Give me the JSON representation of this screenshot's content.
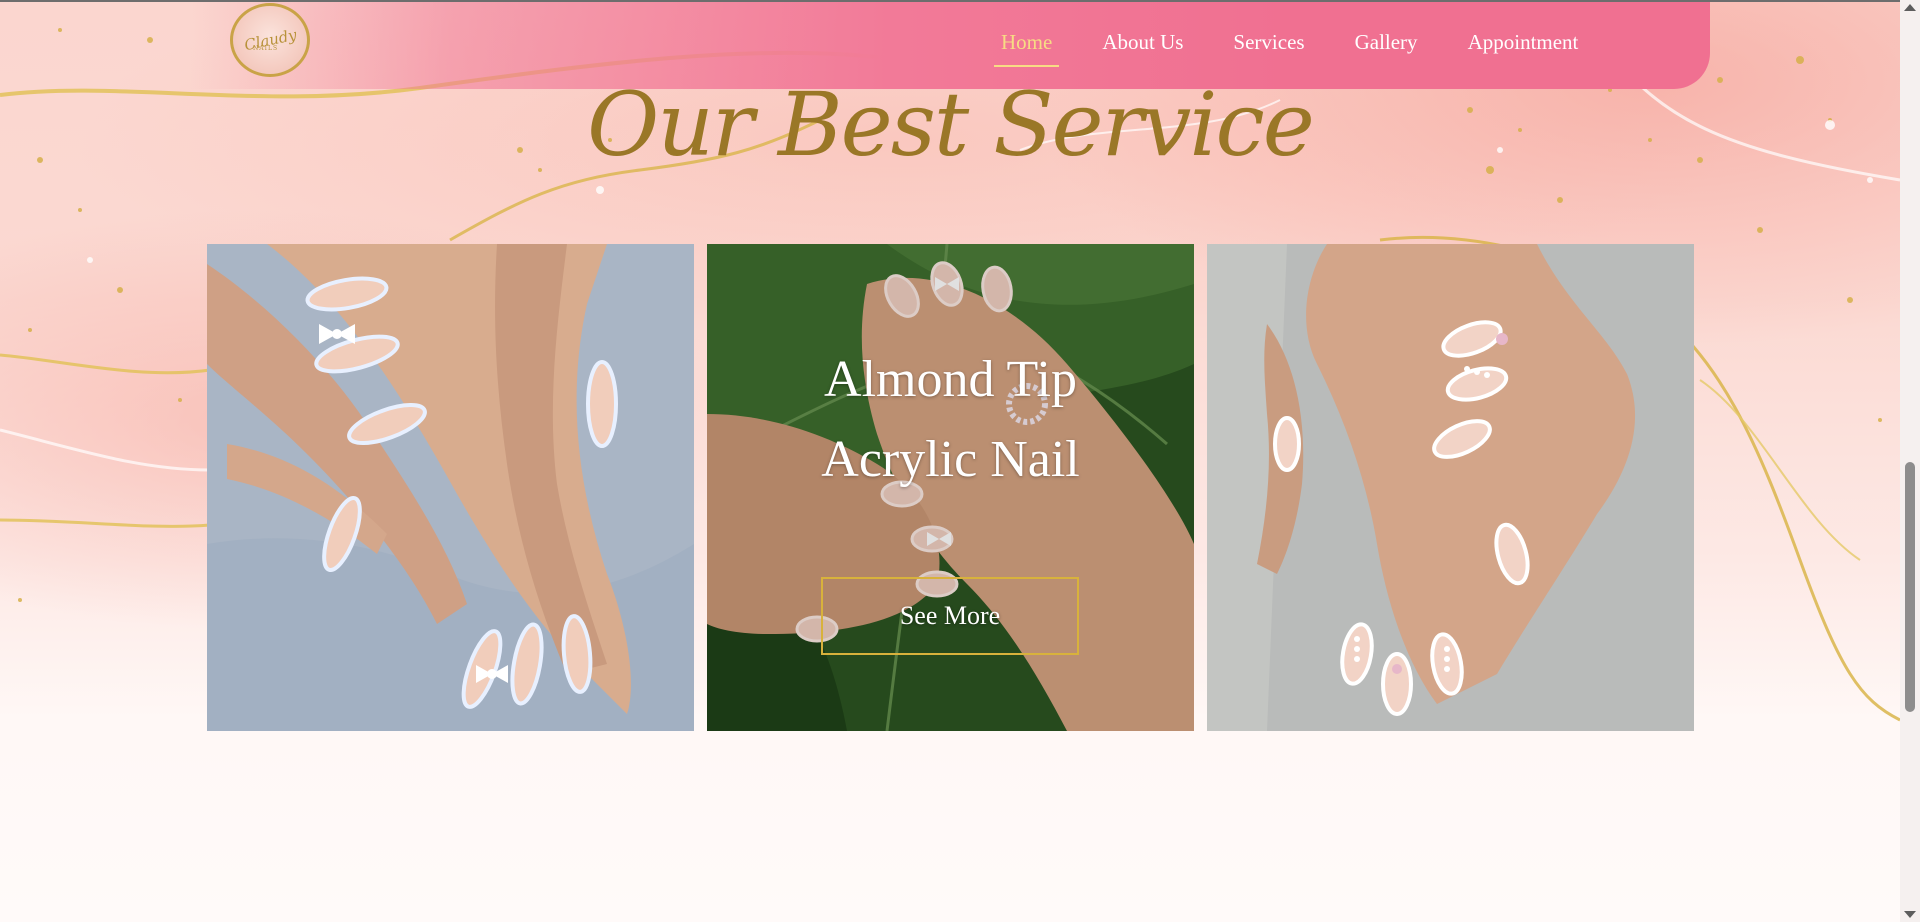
{
  "header": {
    "logo_text": "Claudy",
    "logo_subtext": "NAILS",
    "nav": [
      {
        "label": "Home",
        "active": true
      },
      {
        "label": "About Us",
        "active": false
      },
      {
        "label": "Services",
        "active": false
      },
      {
        "label": "Gallery",
        "active": false
      },
      {
        "label": "Appointment",
        "active": false
      }
    ]
  },
  "section": {
    "title": "Our Best Service"
  },
  "cards": [
    {
      "image": "french-tip-bow-nails-photo"
    },
    {
      "image": "almond-tip-acrylic-nails-on-leaf-photo",
      "title_line1": "Almond Tip",
      "title_line2": "Acrylic Nail",
      "button_label": "See More"
    },
    {
      "image": "pearl-french-tip-nails-photo"
    }
  ],
  "colors": {
    "nav_bg": "#f07091",
    "nav_active": "#f7dc84",
    "title_gold": "#9a7727",
    "button_border": "#d8b23c"
  }
}
